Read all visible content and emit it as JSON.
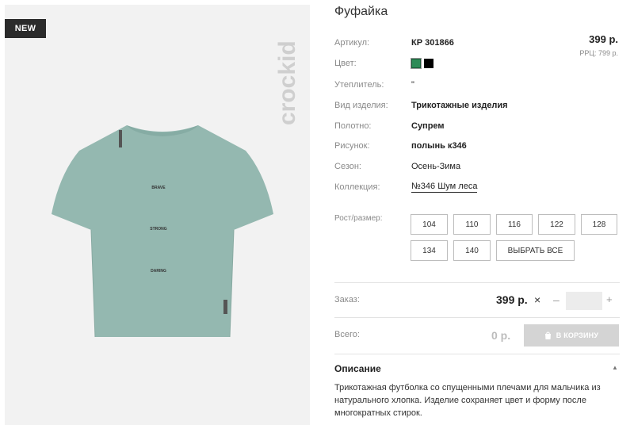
{
  "badge": "NEW",
  "brand": "crockid",
  "shirt_prints": [
    "BRAVE",
    "STRONG",
    "DARING"
  ],
  "product": {
    "title": "Фуфайка",
    "price": "399 р.",
    "rrp": "РРЦ: 799 р.",
    "colors": [
      "#2e8b57",
      "#000000"
    ],
    "props": [
      {
        "label": "Артикул:",
        "value": "КР 301866"
      },
      {
        "label": "Цвет:",
        "value": ""
      },
      {
        "label": "Утеплитель:",
        "value": "\""
      },
      {
        "label": "Вид изделия:",
        "value": "Трикотажные изделия"
      },
      {
        "label": "Полотно:",
        "value": "Супрем"
      },
      {
        "label": "Рисунок:",
        "value": "полынь к346"
      },
      {
        "label": "Сезон:",
        "value": "Осень-Зима"
      },
      {
        "label": "Коллекция:",
        "value": "№346 Шум леса"
      }
    ]
  },
  "sizes": {
    "label": "Рост/размер:",
    "options": [
      "104",
      "110",
      "116",
      "122",
      "128",
      "134",
      "140"
    ],
    "select_all": "ВЫБРАТЬ ВСЕ"
  },
  "order": {
    "label": "Заказ:",
    "price": "399 р.",
    "times": "×",
    "minus": "–",
    "plus": "+",
    "qty": ""
  },
  "total": {
    "label": "Всего:",
    "value": "0 р.",
    "cart_button": "В КОРЗИНУ"
  },
  "description": {
    "title": "Описание",
    "text": "Трикотажная футболка со спущенными плечами для мальчика из натурального хлопка. Изделие сохраняет цвет и форму после многократных стирок."
  }
}
